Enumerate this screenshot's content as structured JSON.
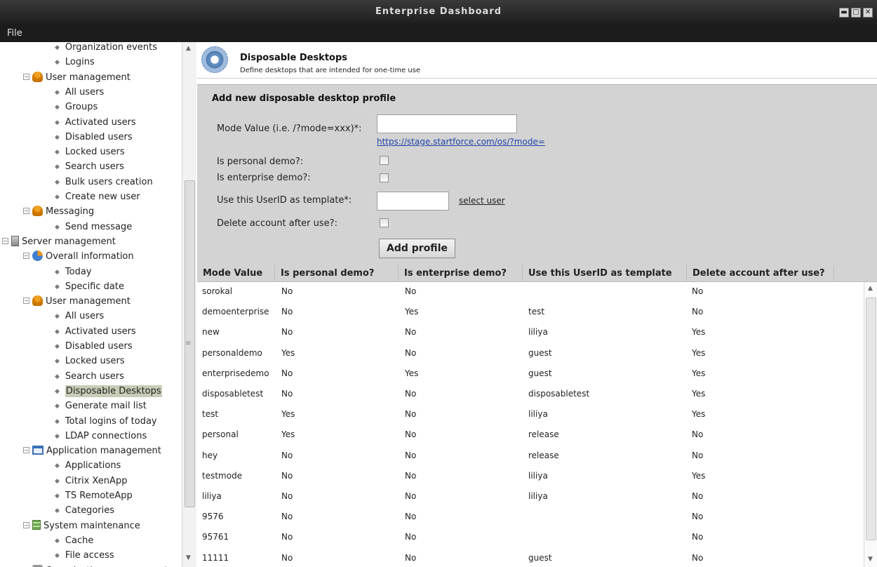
{
  "window": {
    "title": "Enterprise Dashboard",
    "controls": [
      "▬",
      "□",
      "✕"
    ]
  },
  "menu": {
    "file": "File"
  },
  "sidebar": {
    "items": [
      {
        "label": "Organization events",
        "type": "leaf"
      },
      {
        "label": "Logins",
        "type": "leaf"
      },
      {
        "label": "User management",
        "type": "group",
        "icon": "user-icon"
      },
      {
        "label": "All users",
        "type": "leaf"
      },
      {
        "label": "Groups",
        "type": "leaf"
      },
      {
        "label": "Activated users",
        "type": "leaf"
      },
      {
        "label": "Disabled users",
        "type": "leaf"
      },
      {
        "label": "Locked users",
        "type": "leaf"
      },
      {
        "label": "Search users",
        "type": "leaf"
      },
      {
        "label": "Bulk users creation",
        "type": "leaf"
      },
      {
        "label": "Create new user",
        "type": "leaf"
      },
      {
        "label": "Messaging",
        "type": "group",
        "icon": "user-icon"
      },
      {
        "label": "Send message",
        "type": "leaf"
      },
      {
        "label": "Server management",
        "type": "group",
        "icon": "server-icon"
      },
      {
        "label": "Overall information",
        "type": "group",
        "icon": "pie-chart-icon"
      },
      {
        "label": "Today",
        "type": "leaf"
      },
      {
        "label": "Specific date",
        "type": "leaf"
      },
      {
        "label": "User management",
        "type": "group",
        "icon": "user-icon"
      },
      {
        "label": "All users",
        "type": "leaf"
      },
      {
        "label": "Activated users",
        "type": "leaf"
      },
      {
        "label": "Disabled users",
        "type": "leaf"
      },
      {
        "label": "Locked users",
        "type": "leaf"
      },
      {
        "label": "Search users",
        "type": "leaf"
      },
      {
        "label": "Disposable Desktops",
        "type": "leaf",
        "selected": true
      },
      {
        "label": "Generate mail list",
        "type": "leaf"
      },
      {
        "label": "Total logins of today",
        "type": "leaf"
      },
      {
        "label": "LDAP connections",
        "type": "leaf"
      },
      {
        "label": "Application management",
        "type": "group",
        "icon": "window-icon"
      },
      {
        "label": "Applications",
        "type": "leaf"
      },
      {
        "label": "Citrix XenApp",
        "type": "leaf"
      },
      {
        "label": "TS RemoteApp",
        "type": "leaf"
      },
      {
        "label": "Categories",
        "type": "leaf"
      },
      {
        "label": "System maintenance",
        "type": "group",
        "icon": "maintenance-icon"
      },
      {
        "label": "Cache",
        "type": "leaf"
      },
      {
        "label": "File access",
        "type": "leaf"
      },
      {
        "label": "Organization management",
        "type": "group",
        "icon": "organization-icon"
      }
    ]
  },
  "header": {
    "title": "Disposable Desktops",
    "subtitle": "Define desktops that are intended for one-time use"
  },
  "form": {
    "title": "Add new disposable desktop profile",
    "mode_label": "Mode Value (i.e. /?mode=xxx)*:",
    "mode_value": "",
    "mode_url": "https://stage.startforce.com/os/?mode=",
    "personal_label": "Is personal demo?:",
    "enterprise_label": "Is enterprise demo?:",
    "template_label": "Use this UserID as template*:",
    "template_value": "",
    "select_user": "select user",
    "delete_label": "Delete account after use?:",
    "submit": "Add profile"
  },
  "table": {
    "columns": [
      "Mode Value",
      "Is personal demo?",
      "Is enterprise demo?",
      "Use this UserID as template",
      "Delete account after use?"
    ],
    "rows": [
      [
        "sorokal",
        "No",
        "No",
        "",
        "No"
      ],
      [
        "demoenterprise",
        "No",
        "Yes",
        "test",
        "No"
      ],
      [
        "new",
        "No",
        "No",
        "liliya",
        "Yes"
      ],
      [
        "personaldemo",
        "Yes",
        "No",
        "guest",
        "Yes"
      ],
      [
        "enterprisedemo",
        "No",
        "Yes",
        "guest",
        "Yes"
      ],
      [
        "disposabletest",
        "No",
        "No",
        "disposabletest",
        "Yes"
      ],
      [
        "test",
        "Yes",
        "No",
        "liliya",
        "Yes"
      ],
      [
        "personal",
        "Yes",
        "No",
        "release",
        "No"
      ],
      [
        "hey",
        "No",
        "No",
        "release",
        "No"
      ],
      [
        "testmode",
        "No",
        "No",
        "liliya",
        "Yes"
      ],
      [
        "liliya",
        "No",
        "No",
        "liliya",
        "No"
      ],
      [
        "9576",
        "No",
        "No",
        "",
        "No"
      ],
      [
        "95761",
        "No",
        "No",
        "",
        "No"
      ],
      [
        "11111",
        "No",
        "No",
        "guest",
        "No"
      ]
    ]
  }
}
